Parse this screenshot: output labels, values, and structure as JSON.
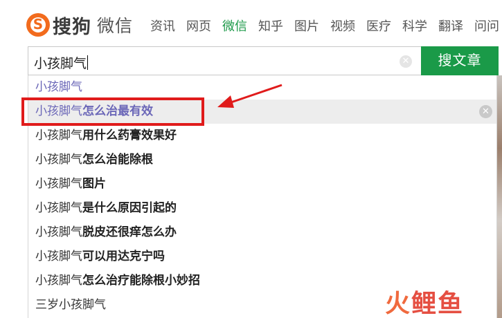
{
  "header": {
    "logo_text": "搜狗",
    "logo_sub": "微信",
    "nav": [
      "资讯",
      "网页",
      "微信",
      "知乎",
      "图片",
      "视频",
      "医疗",
      "科学",
      "翻译",
      "问问"
    ],
    "active_nav": "微信"
  },
  "search": {
    "query": "小孩脚气",
    "button_label": "搜文章",
    "clear_icon": "✕"
  },
  "suggestions": [
    {
      "q": "小孩脚气",
      "rest": ""
    },
    {
      "q": "小孩脚气",
      "rest": "怎么治最有效"
    },
    {
      "q": "小孩脚气",
      "rest": "用什么药膏效果好"
    },
    {
      "q": "小孩脚气",
      "rest": "怎么治能除根"
    },
    {
      "q": "小孩脚气",
      "rest": "图片"
    },
    {
      "q": "小孩脚气",
      "rest": "是什么原因引起的"
    },
    {
      "q": "小孩脚气",
      "rest": "脱皮还很痒怎么办"
    },
    {
      "q": "小孩脚气",
      "rest": "可以用达克宁吗"
    },
    {
      "q": "小孩脚气",
      "rest": "怎么治疗能除根小妙招"
    },
    {
      "q": "三岁小孩脚气",
      "rest": ""
    }
  ],
  "watermark": {
    "part1": "火",
    "part2": "鲤鱼"
  },
  "colors": {
    "accent": "#1a9a48",
    "annotation": "#e01b1b",
    "logo": "#f26b1d"
  }
}
